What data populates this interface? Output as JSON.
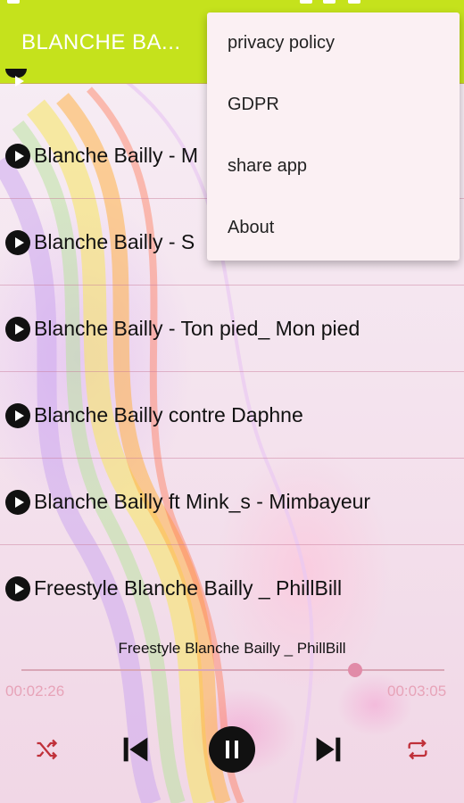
{
  "app": {
    "title": "BLANCHE BA...",
    "accent_color": "#c5e21c"
  },
  "menu": {
    "items": [
      {
        "label": "privacy policy"
      },
      {
        "label": "GDPR"
      },
      {
        "label": "share app"
      },
      {
        "label": "About"
      }
    ]
  },
  "tracks": [
    {
      "label": "Blanche Bailly - M"
    },
    {
      "label": "Blanche Bailly - S"
    },
    {
      "label": "Blanche Bailly - Ton pied_ Mon pied"
    },
    {
      "label": "Blanche Bailly contre Daphne"
    },
    {
      "label": "Blanche Bailly ft Mink_s  - Mimbayeur"
    },
    {
      "label": "Freestyle Blanche Bailly _ PhillBill"
    }
  ],
  "player": {
    "now_playing": "Freestyle Blanche Bailly _ PhillBill",
    "elapsed": "00:02:26",
    "duration": "00:03:05",
    "progress_fraction": 0.79,
    "state": "playing",
    "controls": [
      "shuffle-icon",
      "previous-icon",
      "pause-icon",
      "next-icon",
      "repeat-icon"
    ]
  }
}
